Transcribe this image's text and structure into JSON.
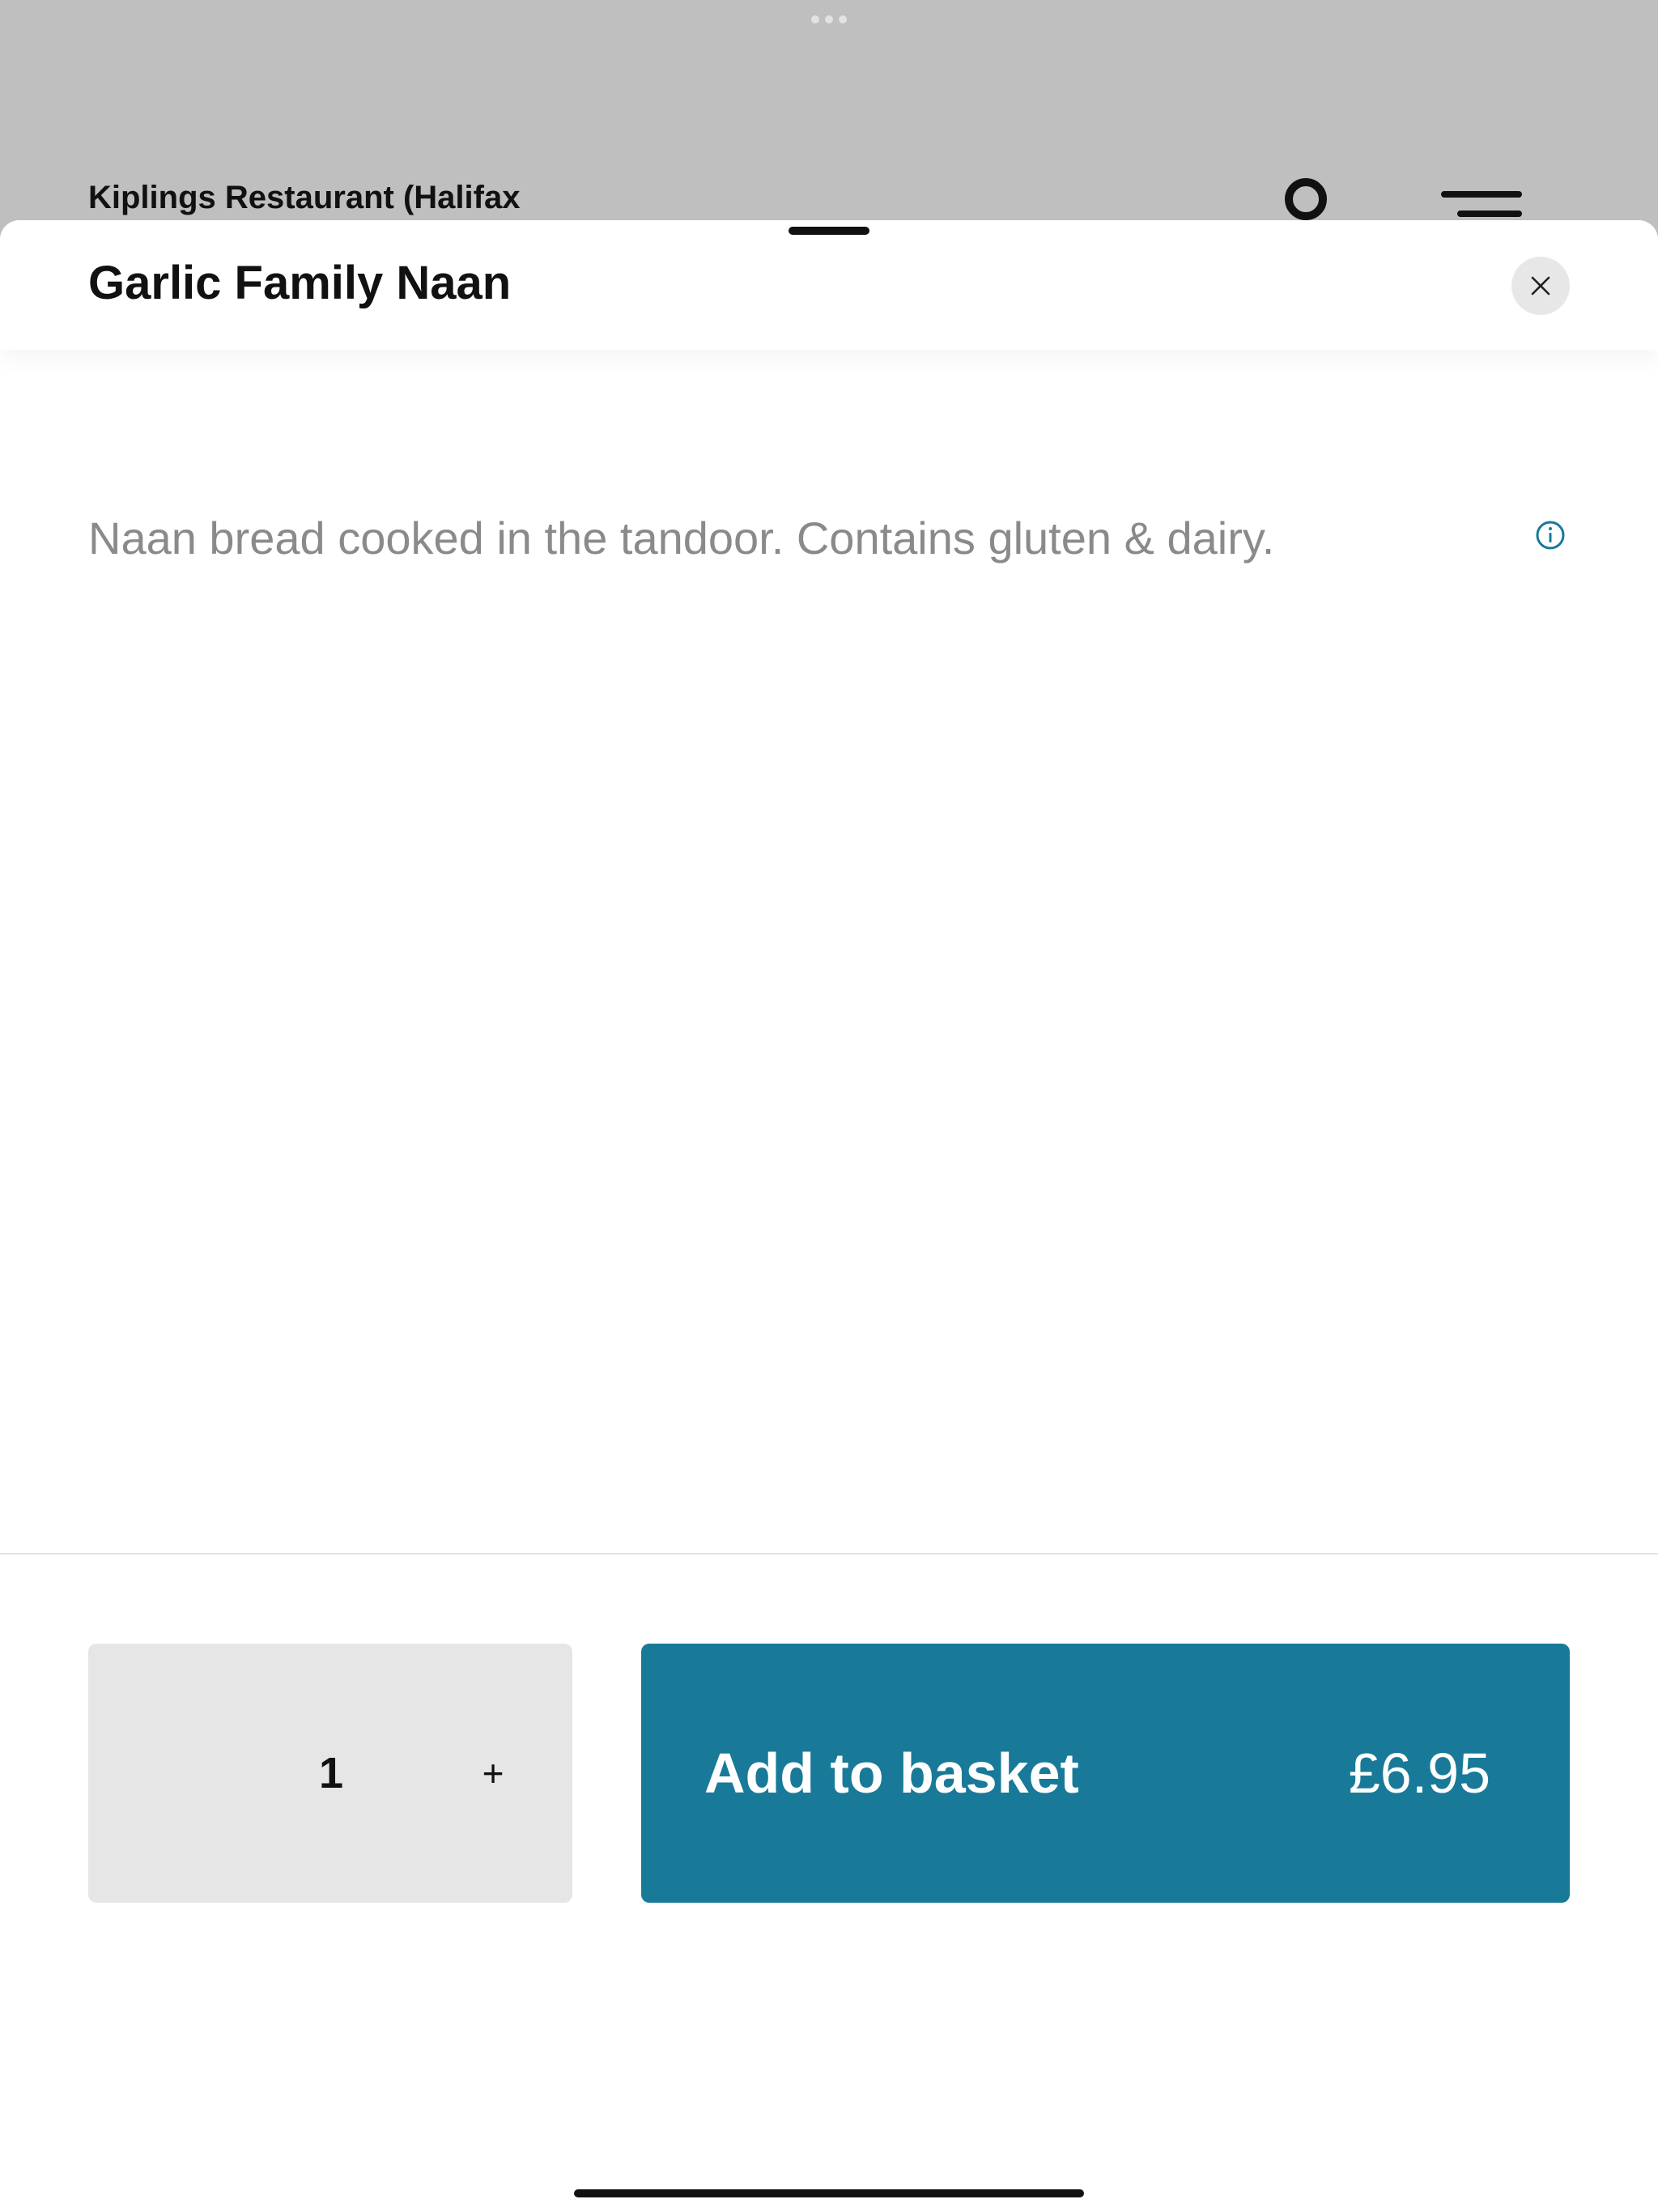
{
  "background": {
    "restaurant_name": "Kiplings Restaurant (Halifax"
  },
  "item": {
    "title": "Garlic Family Naan",
    "description": "Naan bread cooked in the tandoor. Contains gluten & dairy."
  },
  "quantity": {
    "value": "1",
    "increment_label": "+"
  },
  "add_to_basket": {
    "label": "Add to basket",
    "price": "£6.95"
  },
  "icons": {
    "close": "close-icon",
    "info": "info-icon",
    "account": "account-icon",
    "menu": "menu-icon"
  },
  "colors": {
    "accent": "#187a98",
    "background_dim": "#bfbfbf",
    "stepper_bg": "#e6e6e6",
    "description_text": "#8a8a8a"
  }
}
